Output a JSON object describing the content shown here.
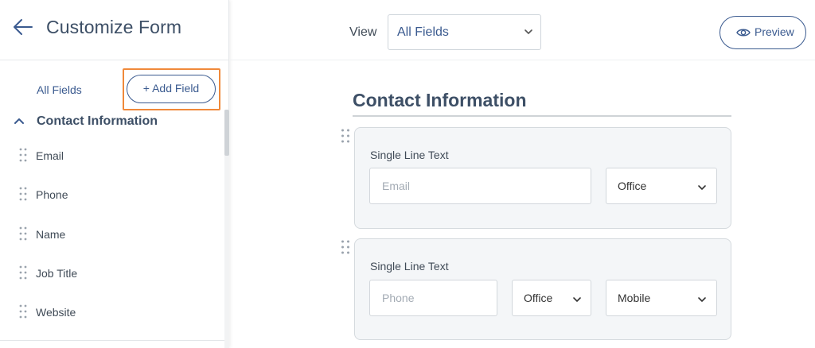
{
  "sidebar": {
    "title": "Customize Form",
    "all_fields_link": "All Fields",
    "add_field_button": "+ Add Field",
    "section": {
      "title": "Contact Information",
      "items": [
        {
          "label": "Email"
        },
        {
          "label": "Phone"
        },
        {
          "label": "Name"
        },
        {
          "label": "Job Title"
        },
        {
          "label": "Website"
        }
      ]
    }
  },
  "topbar": {
    "view_label": "View",
    "view_select_value": "All Fields",
    "preview_button": "Preview"
  },
  "main": {
    "section_title": "Contact Information",
    "cards": [
      {
        "label": "Single Line Text",
        "input_placeholder": "Email",
        "selects": [
          "Office"
        ]
      },
      {
        "label": "Single Line Text",
        "input_placeholder": "Phone",
        "selects": [
          "Office",
          "Mobile"
        ]
      }
    ]
  },
  "colors": {
    "accent": "#3a5a8f",
    "highlight": "#f0893a",
    "card_bg": "#f4f6f8"
  }
}
